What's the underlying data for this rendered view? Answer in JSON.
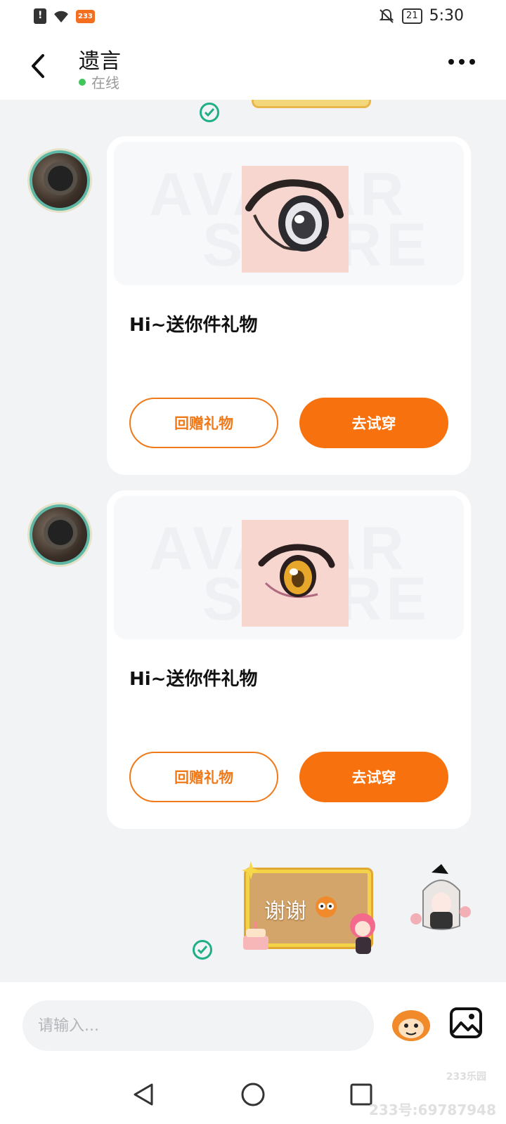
{
  "status_bar": {
    "app_badge": "233",
    "battery": "21",
    "time": "5:30"
  },
  "header": {
    "title": "遗言",
    "status": "在线"
  },
  "messages": [
    {
      "watermark_line1": "AVATAR",
      "watermark_line2": "STORE",
      "text": "Hi~送你件礼物",
      "return_label": "回赠礼物",
      "try_label": "去试穿"
    },
    {
      "watermark_line1": "AVATAR",
      "watermark_line2": "STORE",
      "text": "Hi~送你件礼物",
      "return_label": "回赠礼物",
      "try_label": "去试穿"
    }
  ],
  "sticker": {
    "text": "谢谢"
  },
  "input": {
    "placeholder": "请输入..."
  },
  "watermark": {
    "brand": "233乐园",
    "id": "233号:69787948"
  },
  "colors": {
    "accent": "#f7710f",
    "online": "#3ec65a",
    "check": "#1fae86"
  }
}
